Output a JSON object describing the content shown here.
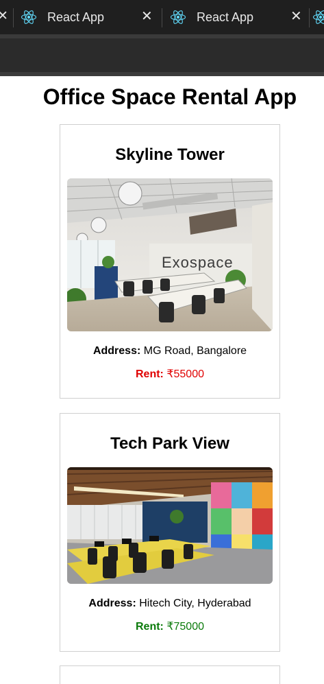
{
  "browser": {
    "tabs": [
      {
        "title": "React App",
        "close_glyph": "✕",
        "icon": "react-logo-icon"
      },
      {
        "title": "React App",
        "close_glyph": "✕",
        "icon": "react-logo-icon"
      }
    ],
    "edge_close_glyph": "✕",
    "icon_color": "#61dafb"
  },
  "app": {
    "title": "Office Space Rental App",
    "offices": [
      {
        "name": "Skyline Tower",
        "address_label": "Address:",
        "address": "MG Road, Bangalore",
        "rent_label": "Rent:",
        "rent": "₹55000",
        "rent_color": "#e00000",
        "photo_sign": "Exospace"
      },
      {
        "name": "Tech Park View",
        "address_label": "Address:",
        "address": "Hitech City, Hyderabad",
        "rent_label": "Rent:",
        "rent": "₹75000",
        "rent_color": "#0a7a0a"
      }
    ]
  }
}
